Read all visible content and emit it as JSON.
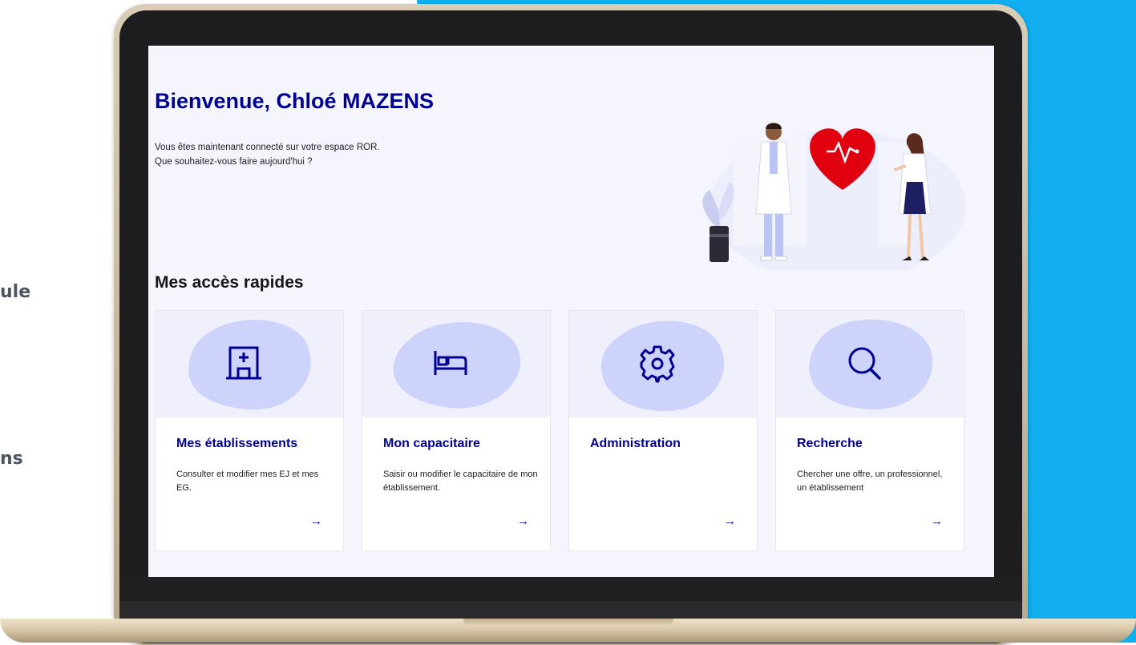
{
  "side_labels": [
    "ule",
    "ns"
  ],
  "welcome": {
    "title": "Bienvenue, Chloé MAZENS",
    "line1": "Vous êtes maintenant connecté sur votre espace ROR.",
    "line2": "Que souhaitez-vous faire aujourd'hui ?"
  },
  "quick_access": {
    "heading": "Mes accès rapides",
    "cards": [
      {
        "title": "Mes établissements",
        "description": "Consulter et modifier mes EJ et mes EG.",
        "icon": "hospital-building-icon",
        "arrow": "→"
      },
      {
        "title": "Mon capacitaire",
        "description": "Saisir ou modifier le capacitaire de mon établissement.",
        "icon": "bed-icon",
        "arrow": "→"
      },
      {
        "title": "Administration",
        "description": "",
        "icon": "gear-icon",
        "arrow": "→"
      },
      {
        "title": "Recherche",
        "description": "Chercher une offre, un professionnel, un établissement",
        "icon": "search-icon",
        "arrow": "→"
      }
    ]
  },
  "colors": {
    "primary": "#000091",
    "accent_blue": "#11aef0",
    "heart": "#e1000f",
    "screen_bg": "#f5f5fe",
    "blob": "#cdd3fb"
  }
}
